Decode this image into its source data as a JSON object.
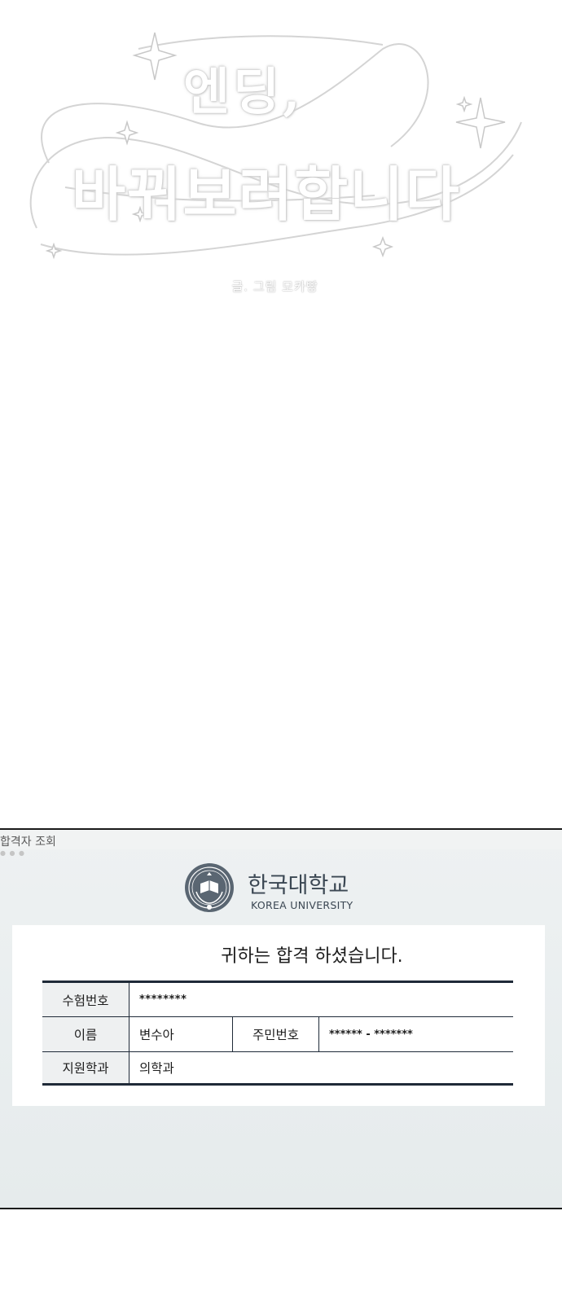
{
  "title_logo": {
    "line1": "엔딩,",
    "line2": "바꿔보려합니다",
    "credit": "글. 그림 모카빵"
  },
  "window": {
    "tab_label": "합격자 조회",
    "university": {
      "name_ko": "한국대학교",
      "name_en": "KOREA UNIVERSITY"
    },
    "result_message": "귀하는 합격 하셨습니다.",
    "table": {
      "exam_number_label": "수험번호",
      "exam_number_value": "********",
      "name_label": "이름",
      "name_value": "변수아",
      "resident_number_label": "주민번호",
      "resident_number_value": "****** - *******",
      "department_label": "지원학과",
      "department_value": "의학과"
    }
  },
  "colors": {
    "table_border": "#1f2a38",
    "university_text": "#3b4753",
    "panel_background": "#e9eeef"
  }
}
